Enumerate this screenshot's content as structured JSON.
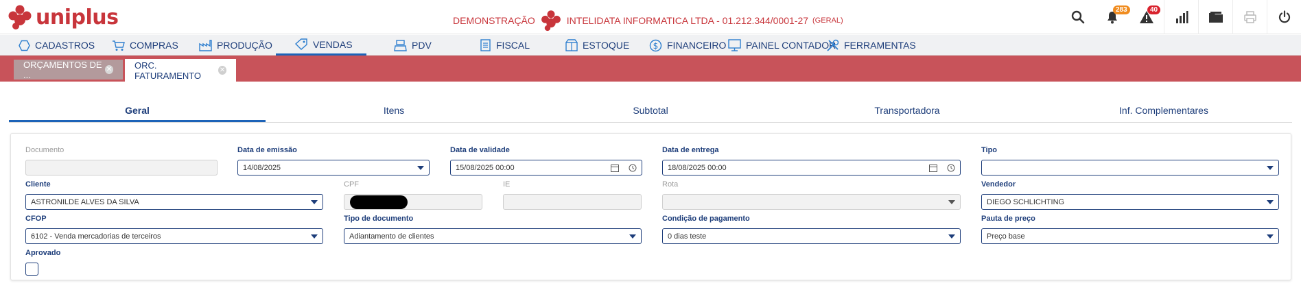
{
  "app": {
    "logo_text": "uniplus",
    "brand_color": "#c8353b"
  },
  "header": {
    "mode": "DEMONSTRAÇÃO",
    "company": "INTELIDATA INFORMATICA LTDA - 01.212.344/0001-27",
    "group": "(GERAL)",
    "notifications_count": "283",
    "alerts_count": "40"
  },
  "menu": [
    {
      "label": "CADASTROS",
      "icon": "hexagon-icon"
    },
    {
      "label": "COMPRAS",
      "icon": "cart-icon"
    },
    {
      "label": "PRODUÇÃO",
      "icon": "factory-icon"
    },
    {
      "label": "VENDAS",
      "icon": "tag-icon"
    },
    {
      "label": "PDV",
      "icon": "register-icon"
    },
    {
      "label": "FISCAL",
      "icon": "document-icon"
    },
    {
      "label": "ESTOQUE",
      "icon": "box-icon"
    },
    {
      "label": "FINANCEIRO",
      "icon": "dollar-icon"
    },
    {
      "label": "PAINEL CONTADOR",
      "icon": "monitor-icon"
    },
    {
      "label": "FERRAMENTAS",
      "icon": "tools-icon"
    }
  ],
  "doc_tabs": [
    {
      "label": "ORÇAMENTOS DE ...",
      "active": false
    },
    {
      "label": "ORC. FATURAMENTO",
      "active": true
    }
  ],
  "section_tabs": [
    "Geral",
    "Itens",
    "Subtotal",
    "Transportadora",
    "Inf. Complementares"
  ],
  "form": {
    "documento": {
      "label": "Documento",
      "value": ""
    },
    "data_emissao": {
      "label": "Data de emissão",
      "value": "14/08/2025"
    },
    "data_validade": {
      "label": "Data de validade",
      "value": "15/08/2025 00:00"
    },
    "data_entrega": {
      "label": "Data de entrega",
      "value": "18/08/2025 00:00"
    },
    "tipo": {
      "label": "Tipo",
      "value": ""
    },
    "cliente": {
      "label": "Cliente",
      "value": "ASTRONILDE ALVES DA SILVA"
    },
    "cpf": {
      "label": "CPF"
    },
    "ie": {
      "label": "IE",
      "value": ""
    },
    "rota": {
      "label": "Rota",
      "value": ""
    },
    "vendedor": {
      "label": "Vendedor",
      "value": "DIEGO SCHLICHTING"
    },
    "cfop": {
      "label": "CFOP",
      "value": "6102 - Venda mercadorias de terceiros"
    },
    "tipo_documento": {
      "label": "Tipo de documento",
      "value": "Adiantamento de clientes"
    },
    "condicao_pagamento": {
      "label": "Condição de pagamento",
      "value": "0 dias teste"
    },
    "pauta_preco": {
      "label": "Pauta de preço",
      "value": "Preço base"
    },
    "aprovado": {
      "label": "Aprovado",
      "checked": false
    }
  }
}
